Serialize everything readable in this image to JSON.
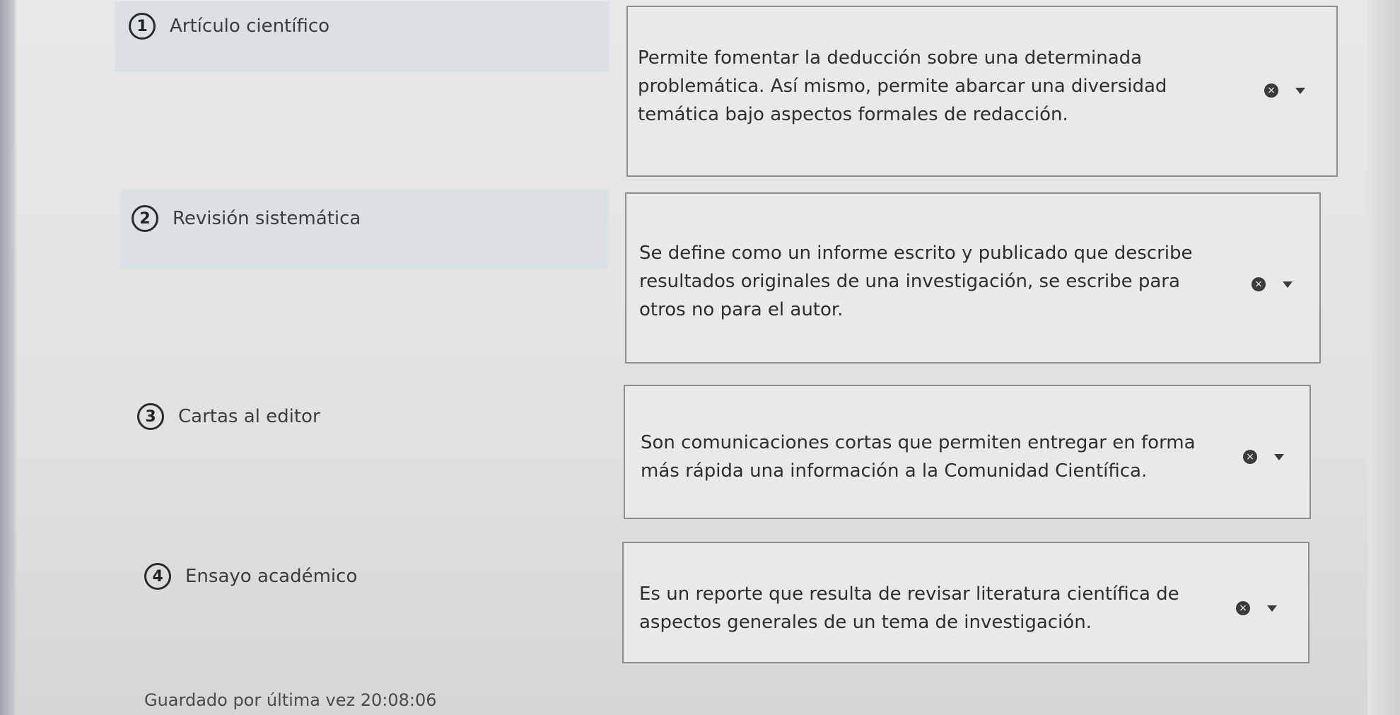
{
  "pairs": [
    {
      "number": "1",
      "term": "Artículo científico",
      "definition": [
        "Permite fomentar la deducción sobre una determinada",
        "problemática. Así mismo, permite abarcar una diversidad",
        "temática bajo aspectos formales de redacción."
      ]
    },
    {
      "number": "2",
      "term": "Revisión sistemática",
      "definition": [
        "Se define como un informe escrito y publicado que describe",
        "resultados originales de una investigación, se escribe para",
        "otros no para el autor."
      ]
    },
    {
      "number": "3",
      "term": "Cartas al editor",
      "definition": [
        "Son comunicaciones cortas que permiten entregar en forma",
        "más rápida una información a la Comunidad Científica."
      ]
    },
    {
      "number": "4",
      "term": "Ensayo académico",
      "definition": [
        "Es un reporte que resulta de revisar literatura científica de",
        "aspectos generales de un tema de investigación."
      ]
    }
  ],
  "footer": {
    "label": "Guardado por última vez",
    "time": "20:08:06"
  },
  "icons": {
    "clear": "clear-icon",
    "dropdown": "chevron-down-icon"
  }
}
